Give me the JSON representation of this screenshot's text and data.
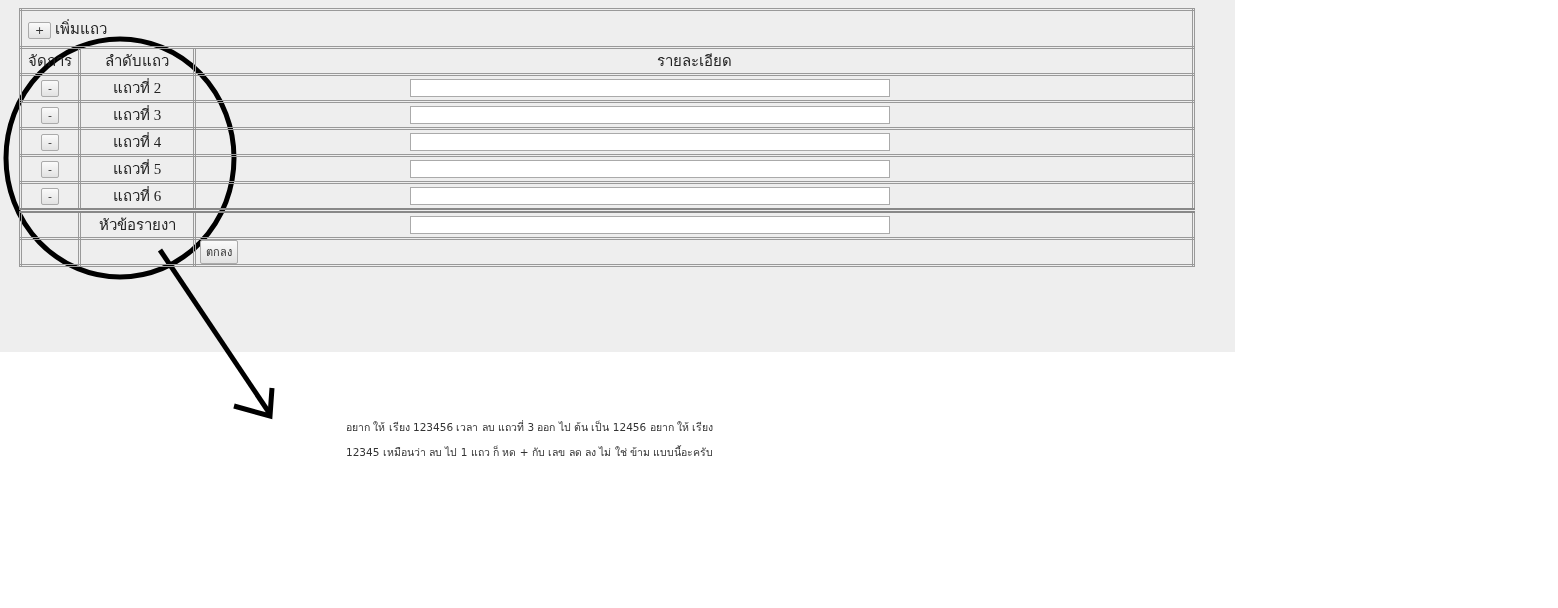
{
  "add_row": {
    "icon": "+",
    "label": "เพิ่มแถว"
  },
  "columns": [
    "จัดการ",
    "ลำดับแถว",
    "รายละเอียด"
  ],
  "rows": [
    {
      "remove": "-",
      "label": "แถวที่ 2"
    },
    {
      "remove": "-",
      "label": "แถวที่ 3"
    },
    {
      "remove": "-",
      "label": "แถวที่ 4"
    },
    {
      "remove": "-",
      "label": "แถวที่ 5"
    },
    {
      "remove": "-",
      "label": "แถวที่ 6"
    }
  ],
  "title_row": {
    "label": "หัวข้อรายงา"
  },
  "submit": "ตกลง",
  "note": [
    "อยาก ให้ เรียง 123456 เวลา ลบ แถวที่ 3 ออก ไป ต้น เป็น 12456 อยาก ให้ เรียง",
    "12345 เหมือนว่า ลบ ไป 1 แถว ก็ หด + กับ เลข ลด ลง ไม่ ใช่ ข้าม แบบนี้อะครับ"
  ]
}
